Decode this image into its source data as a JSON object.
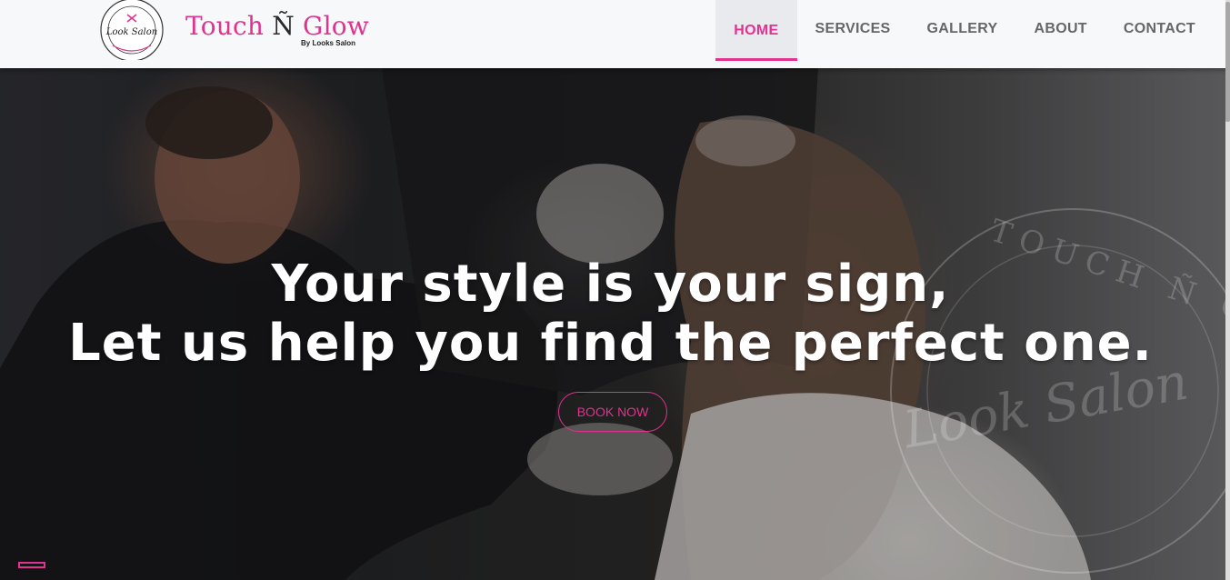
{
  "brand": {
    "name_part1": "Touch ",
    "name_n": "Ñ",
    "name_part2": " Glow",
    "subtitle": "By Looks Salon",
    "logo_script": "Look Salon",
    "accent_color": "#e0338f"
  },
  "nav": {
    "items": [
      {
        "label": "HOME",
        "active": true
      },
      {
        "label": "SERVICES",
        "active": false
      },
      {
        "label": "GALLERY",
        "active": false
      },
      {
        "label": "ABOUT",
        "active": false
      },
      {
        "label": "CONTACT",
        "active": false
      }
    ]
  },
  "hero": {
    "headline_line1": "Your style is your sign,",
    "headline_line2": "Let us help you find the perfect one.",
    "cta_label": "BOOK NOW",
    "watermark_text": "TOUCH Ñ GLOW",
    "watermark_script": "Look Salon"
  }
}
